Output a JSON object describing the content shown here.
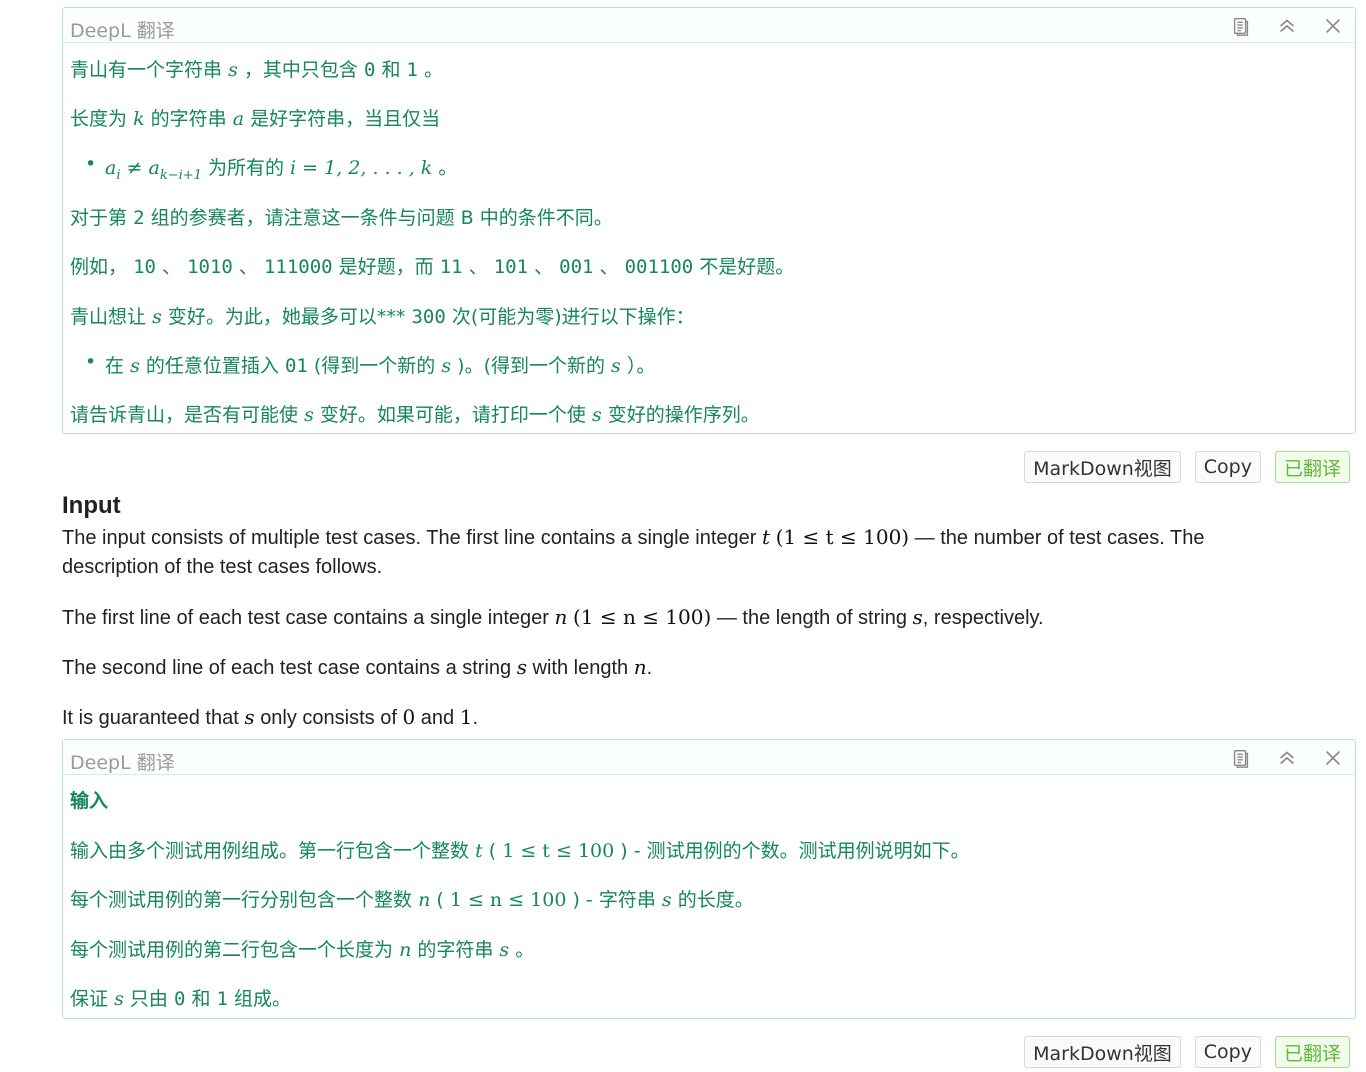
{
  "panel1": {
    "title": "DeepL 翻译",
    "lines": {
      "l1": {
        "a": "青山有一个字符串",
        "v": "s",
        "b": "，其中只包含",
        "c0": "0",
        "and": "和",
        "c1": "1",
        "end": "。"
      },
      "l2": {
        "a": "长度为",
        "k": "k",
        "b": "的字符串",
        "v": "a",
        "c": "是好字符串，当且仅当"
      },
      "l3": {
        "m1": "a",
        "m1sub": "i",
        "neq": "≠",
        "m2": "a",
        "m2sub": "k−i+1",
        "b": "为所有的",
        "m3": "i = 1, 2, . . . , k",
        "end": "。"
      },
      "l4": {
        "a": "对于第",
        "n": "2",
        "b": "组的参赛者，请注意这一条件与问题",
        "B": "B",
        "c": "中的条件不同。"
      },
      "l5": {
        "a": "例如，",
        "e1": "10",
        "s1": "、",
        "e2": "1010",
        "s2": "、",
        "e3": "111000",
        "b": "是好题，而",
        "e4": "11",
        "s3": "、",
        "e5": "101",
        "s4": "、",
        "e6": "001",
        "s5": "、",
        "e7": "001100",
        "c": "不是好题。"
      },
      "l6": {
        "a": "青山想让",
        "v": "s",
        "b": "变好。为此，她最多可以***",
        "n": "300",
        "c": "次(可能为零)进行以下操作："
      },
      "l7": {
        "a": "在",
        "v": "s",
        "b": "的任意位置插入",
        "c01": "01",
        "c": "(得到一个新的",
        "v2": "s",
        "d": ")。(得到一个新的",
        "v3": "s",
        "e": "）。"
      },
      "l8": {
        "a": "请告诉青山，是否有可能使",
        "v": "s",
        "b": "变好。如果可能，请打印一个使",
        "v2": "s",
        "c": "变好的操作序列。"
      }
    }
  },
  "buttons": {
    "markdown": "MarkDown视图",
    "copy": "Copy",
    "translated": "已翻译"
  },
  "input": {
    "title": "Input",
    "p1a": "The input consists of multiple test cases. The first line contains a single integer",
    "p1t": "t",
    "p1math": "(1 ≤ t ≤ 100)",
    "p1b": "— the number of test cases. The description of the test cases follows.",
    "p2a": "The first line of each test case contains a single integer",
    "p2n": "n",
    "p2math": "(1 ≤ n ≤ 100)",
    "p2b": "— the length of string",
    "p2s": "s",
    "p2c": ", respectively.",
    "p3a": "The second line of each test case contains a string",
    "p3s": "s",
    "p3b": "with length",
    "p3n": "n",
    "p3c": ".",
    "p4a": "It is guaranteed that",
    "p4s": "s",
    "p4b": "only consists of",
    "p4z": "0",
    "p4c": "and",
    "p4o": "1",
    "p4d": "."
  },
  "panel2": {
    "title": "DeepL 翻译",
    "heading": "输入",
    "l1": {
      "a": "输入由多个测试用例组成。第一行包含一个整数",
      "t": "t",
      "b": "(",
      "math": "1 ≤ t ≤ 100",
      "c": ") - 测试用例的个数。测试用例说明如下。"
    },
    "l2": {
      "a": "每个测试用例的第一行分别包含一个整数",
      "n": "n",
      "b": "(",
      "math": "1 ≤ n ≤ 100",
      "c": ") - 字符串",
      "s": "s",
      "d": "的长度。"
    },
    "l3": {
      "a": "每个测试用例的第二行包含一个长度为",
      "n": "n",
      "b": "的字符串",
      "s": "s",
      "c": "。"
    },
    "l4": {
      "a": "保证",
      "s": "s",
      "b": "只由",
      "z": "0",
      "c": "和",
      "o": "1",
      "d": "组成。"
    }
  }
}
